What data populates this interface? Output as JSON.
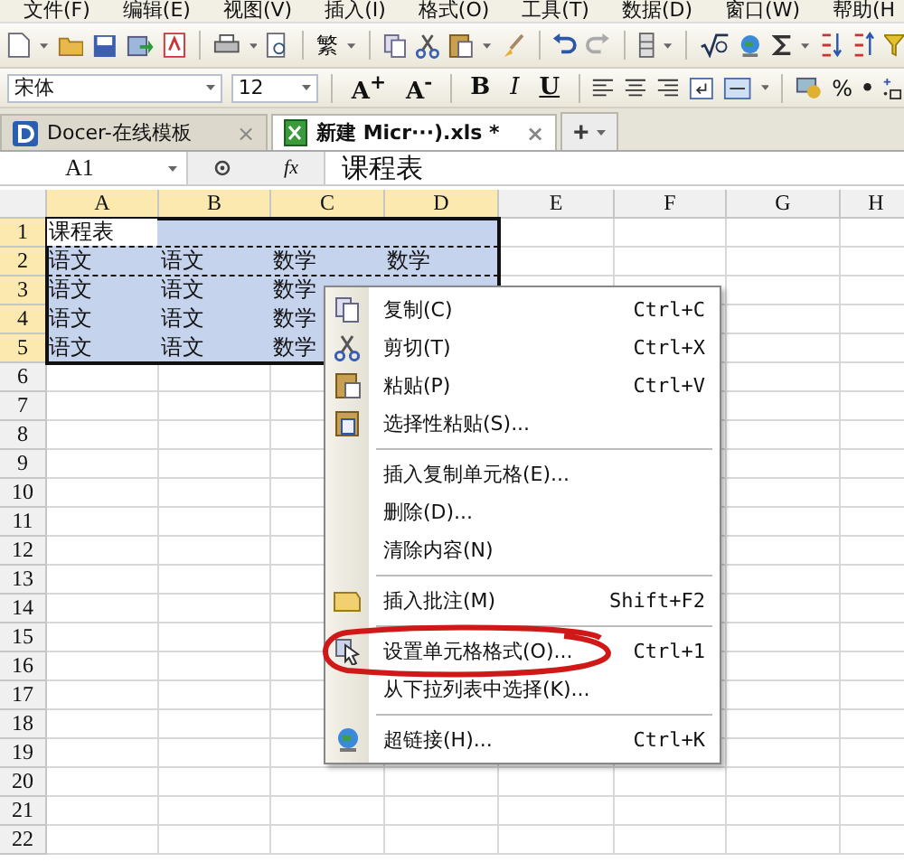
{
  "menu_bar": [
    "文件(F)",
    "编辑(E)",
    "视图(V)",
    "插入(I)",
    "格式(O)",
    "工具(T)",
    "数据(D)",
    "窗口(W)",
    "帮助(H"
  ],
  "toolbar": {
    "text_button": "繁"
  },
  "format_bar": {
    "font": "宋体",
    "size": "12",
    "buttons": [
      "A$^{+}$",
      "A$^{-}$",
      "B",
      "I",
      "U"
    ],
    "percent": "%"
  },
  "tabs": [
    {
      "label": "Docer-在线模板",
      "selected": false,
      "close": "×"
    },
    {
      "label": "新建 Micr···).xls *",
      "selected": true,
      "close": "×"
    }
  ],
  "new_tab": "+",
  "formula_bar": {
    "name_box": "A1",
    "fx": "fx",
    "value": "课程表"
  },
  "sheet": {
    "columns": [
      {
        "label": "A",
        "selected": true
      },
      {
        "label": "B",
        "selected": true
      },
      {
        "label": "C",
        "selected": true
      },
      {
        "label": "D",
        "selected": true
      },
      {
        "label": "E",
        "selected": false
      },
      {
        "label": "F",
        "selected": false
      },
      {
        "label": "G",
        "selected": false
      },
      {
        "label": "H",
        "selected": false
      }
    ],
    "rows": [
      {
        "header": "1",
        "selected": true,
        "copied": false,
        "cells": [
          "课程表"
        ]
      },
      {
        "header": "2",
        "selected": true,
        "copied": true,
        "cells": [
          "语文",
          "语文",
          "数学",
          "数学"
        ]
      },
      {
        "header": "3",
        "selected": true,
        "copied": false,
        "cells": [
          "语文",
          "语文",
          "数学"
        ]
      },
      {
        "header": "4",
        "selected": true,
        "copied": false,
        "cells": [
          "语文",
          "语文",
          "数学"
        ]
      },
      {
        "header": "5",
        "selected": true,
        "copied": false,
        "cells": [
          "语文",
          "语文",
          "数学"
        ]
      },
      {
        "header": "6",
        "selected": false,
        "copied": false
      },
      {
        "header": "7",
        "selected": false,
        "copied": false
      },
      {
        "header": "8",
        "selected": false,
        "copied": false
      },
      {
        "header": "9",
        "selected": false,
        "copied": false
      },
      {
        "header": "10",
        "selected": false,
        "copied": false
      },
      {
        "header": "11",
        "selected": false,
        "copied": false
      },
      {
        "header": "12",
        "selected": false,
        "copied": false
      },
      {
        "header": "13",
        "selected": false,
        "copied": false
      },
      {
        "header": "14",
        "selected": false,
        "copied": false
      },
      {
        "header": "15",
        "selected": false,
        "copied": false
      },
      {
        "header": "16",
        "selected": false,
        "copied": false
      },
      {
        "header": "17",
        "selected": false,
        "copied": false
      },
      {
        "header": "18",
        "selected": false,
        "copied": false
      },
      {
        "header": "19",
        "selected": false,
        "copied": false
      },
      {
        "header": "20",
        "selected": false,
        "copied": false
      },
      {
        "header": "21",
        "selected": false,
        "copied": false
      },
      {
        "header": "22",
        "selected": false,
        "copied": false
      }
    ]
  },
  "context_menu": [
    {
      "kind": "item",
      "label": "复制(C)",
      "shortcut": "Ctrl+C",
      "circled": false
    },
    {
      "kind": "item",
      "label": "剪切(T)",
      "shortcut": "Ctrl+X",
      "circled": false
    },
    {
      "kind": "item",
      "label": "粘贴(P)",
      "shortcut": "Ctrl+V",
      "circled": false
    },
    {
      "kind": "item",
      "label": "选择性粘贴(S)...",
      "circled": false
    },
    {
      "kind": "separator"
    },
    {
      "kind": "item",
      "label": "插入复制单元格(E)...",
      "circled": false
    },
    {
      "kind": "item",
      "label": "删除(D)...",
      "circled": false
    },
    {
      "kind": "item",
      "label": "清除内容(N)",
      "circled": false
    },
    {
      "kind": "separator"
    },
    {
      "kind": "item",
      "label": "插入批注(M)",
      "shortcut": "Shift+F2",
      "circled": false
    },
    {
      "kind": "separator"
    },
    {
      "kind": "item",
      "label": "设置单元格格式(O)...",
      "shortcut": "Ctrl+1",
      "circled": true
    },
    {
      "kind": "item",
      "label": "从下拉列表中选择(K)...",
      "circled": false
    },
    {
      "kind": "separator"
    },
    {
      "kind": "item",
      "label": "超链接(H)...",
      "shortcut": "Ctrl+K",
      "circled": false
    }
  ]
}
